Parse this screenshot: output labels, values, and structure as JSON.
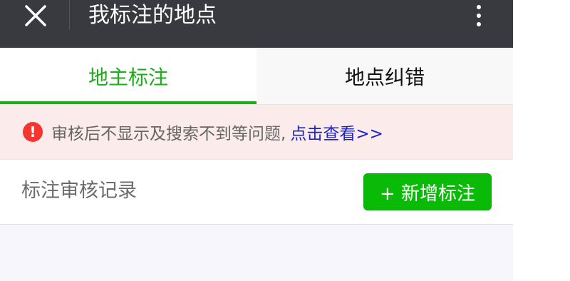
{
  "header": {
    "title": "我标注的地点",
    "close_icon": "close-icon",
    "more_icon": "more-vertical-icon"
  },
  "tabs": [
    {
      "label": "地主标注",
      "active": true
    },
    {
      "label": "地点纠错",
      "active": false
    }
  ],
  "notice": {
    "icon": "alert-circle-icon",
    "icon_glyph": "!",
    "text": "审核后不显示及搜索不到等问题,",
    "link": "点击查看>>"
  },
  "records": {
    "label": "标注审核记录",
    "add_button": "+ 新增标注"
  },
  "colors": {
    "header_bg": "#393a3f",
    "accent_green": "#1aad19",
    "button_green": "#09bb07",
    "notice_bg": "#fcebeb",
    "alert_red": "#f43530",
    "link_blue": "#1b24c9"
  }
}
